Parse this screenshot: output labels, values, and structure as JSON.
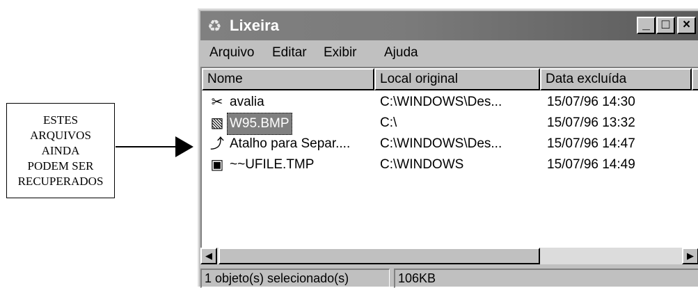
{
  "annotation": {
    "lines": [
      "ESTES",
      "ARQUIVOS",
      "AINDA",
      "PODEM SER",
      "RECUPERADOS"
    ]
  },
  "window": {
    "title": "Lixeira",
    "icon": "recycle-bin-icon",
    "controls": {
      "minimize": "_",
      "maximize": "□",
      "close": "×"
    }
  },
  "menu": [
    "Arquivo",
    "Editar",
    "Exibir",
    "Ajuda"
  ],
  "columns": [
    "Nome",
    "Local original",
    "Data excluída"
  ],
  "files": [
    {
      "name": "avalia",
      "location": "C:\\WINDOWS\\Des...",
      "date": "15/07/96 14:30",
      "icon": "tools-file-icon"
    },
    {
      "name": "W95.BMP",
      "location": "C:\\",
      "date": "15/07/96 13:32",
      "icon": "bitmap-file-icon",
      "selected": true
    },
    {
      "name": "Atalho para Separ....",
      "location": "C:\\WINDOWS\\Des...",
      "date": "15/07/96 14:47",
      "icon": "shortcut-file-icon"
    },
    {
      "name": "~~UFILE.TMP",
      "location": "C:\\WINDOWS",
      "date": "15/07/96 14:49",
      "icon": "document-file-icon"
    }
  ],
  "status": {
    "selected": "1 objeto(s) selecionado(s)",
    "size": "106KB"
  }
}
